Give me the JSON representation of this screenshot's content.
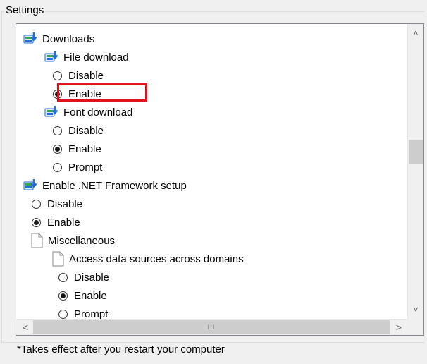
{
  "group_title": "Settings",
  "tree": {
    "items": [
      {
        "label": "Downloads",
        "kind": "folder",
        "icon": "download-settings-icon"
      },
      {
        "label": "File download",
        "kind": "folder",
        "icon": "download-settings-icon"
      },
      {
        "label": "Disable",
        "kind": "radio",
        "checked": false
      },
      {
        "label": "Enable",
        "kind": "radio",
        "checked": true,
        "highlighted": true
      },
      {
        "label": "Font download",
        "kind": "folder",
        "icon": "download-settings-icon"
      },
      {
        "label": "Disable",
        "kind": "radio",
        "checked": false
      },
      {
        "label": "Enable",
        "kind": "radio",
        "checked": true
      },
      {
        "label": "Prompt",
        "kind": "radio",
        "checked": false
      },
      {
        "label": "Enable .NET Framework setup",
        "kind": "folder",
        "icon": "download-settings-icon"
      },
      {
        "label": "Disable",
        "kind": "radio",
        "checked": false
      },
      {
        "label": "Enable",
        "kind": "radio",
        "checked": true
      },
      {
        "label": "Miscellaneous",
        "kind": "page",
        "icon": "page-icon"
      },
      {
        "label": "Access data sources across domains",
        "kind": "page",
        "icon": "page-icon"
      },
      {
        "label": "Disable",
        "kind": "radio",
        "checked": false
      },
      {
        "label": "Enable",
        "kind": "radio",
        "checked": true
      },
      {
        "label": "Prompt",
        "kind": "radio",
        "checked": false
      }
    ]
  },
  "scrollbars": {
    "vertical": {
      "up": "˄",
      "down": "˅"
    },
    "horizontal": {
      "left": "<",
      "right": ">",
      "grip": "III"
    }
  },
  "footer_note": "*Takes effect after you restart your computer",
  "colors": {
    "highlight": "#e0121b",
    "icon_blue": "#1e6fd9",
    "icon_green": "#3aa84a"
  }
}
